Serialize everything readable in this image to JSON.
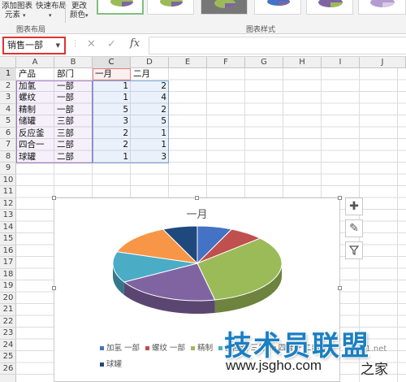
{
  "ribbon": {
    "add_element_label": "添加图表",
    "add_element_label2": "元素",
    "quick_layout_label": "快速布局",
    "change_color_label": "更改",
    "change_color_label2": "颜色",
    "group_layout": "图表布局",
    "group_styles": "图表样式"
  },
  "formula_bar": {
    "name_box": "销售一部",
    "fx": "fx",
    "value": ""
  },
  "grid": {
    "columns": [
      "A",
      "B",
      "C",
      "D",
      "E",
      "F",
      "G",
      "H",
      "I",
      "J"
    ],
    "rows": [
      "1",
      "2",
      "3",
      "4",
      "5",
      "6",
      "7",
      "8",
      "9",
      "10",
      "11",
      "12",
      "13",
      "14",
      "15",
      "16",
      "17",
      "18",
      "19",
      "20",
      "21",
      "22",
      "23",
      "24",
      "25",
      "26"
    ],
    "header_row": [
      "产品",
      "部门",
      "一月",
      "二月"
    ],
    "data_rows": [
      [
        "加氢",
        "一部",
        "1",
        "2"
      ],
      [
        "螺纹",
        "一部",
        "1",
        "4"
      ],
      [
        "精制",
        "一部",
        "5",
        "2"
      ],
      [
        "储罐",
        "三部",
        "3",
        "5"
      ],
      [
        "反应釜",
        "三部",
        "2",
        "1"
      ],
      [
        "四合一",
        "二部",
        "2",
        "1"
      ],
      [
        "球罐",
        "二部",
        "1",
        "3"
      ]
    ]
  },
  "chart_data": {
    "type": "pie",
    "title": "一月",
    "categories": [
      "加氢 一部",
      "螺纹 一部",
      "精制 一部",
      "储罐 三部",
      "反应釜 三部",
      "四合一 二部",
      "球罐 二部"
    ],
    "values": [
      1,
      1,
      5,
      3,
      2,
      2,
      1
    ],
    "colors": [
      "#4472c4",
      "#c0504d",
      "#9bbb59",
      "#8064a2",
      "#4bacc6",
      "#f79646",
      "#1f497d"
    ],
    "legend_position": "bottom",
    "legend_labels": [
      "加氢 一部",
      "螺纹 一部",
      "精制",
      "反应釜 三部",
      "四合一 二部",
      "球罐"
    ]
  },
  "watermark": {
    "name": "技术员联盟",
    "url": "www.jsgho.com",
    "site": "之家",
    "faint": "51.net"
  },
  "colors": {
    "name_box_border": "#d33333",
    "watermark_blue": "#1b7fc2"
  }
}
